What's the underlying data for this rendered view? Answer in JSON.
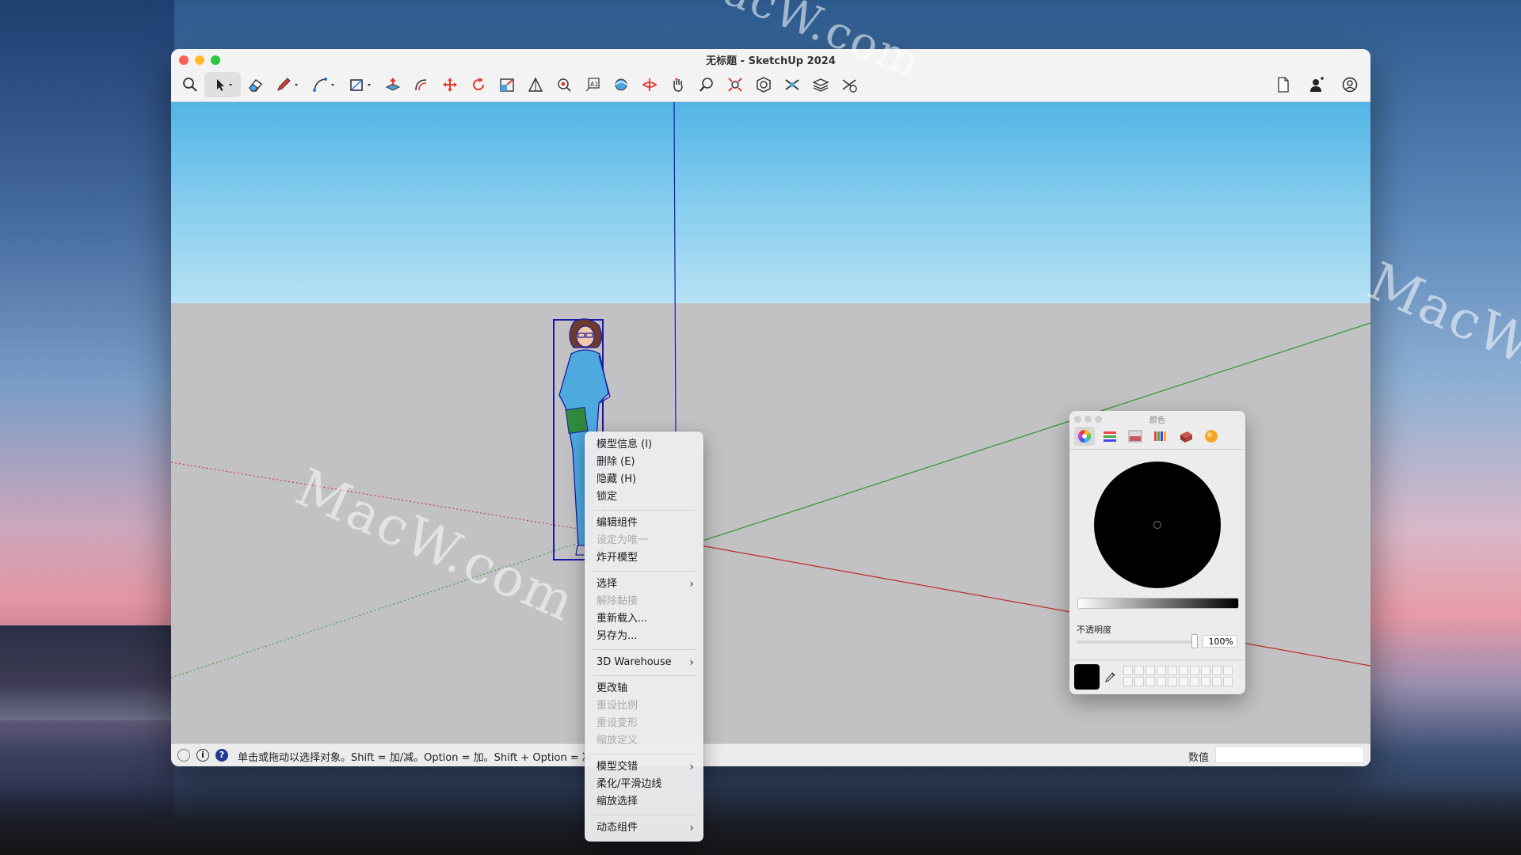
{
  "window": {
    "title": "无标题 - SketchUp 2024"
  },
  "toolbar": {
    "tools": [
      "search-icon",
      "select-icon",
      "eraser-icon",
      "pencil-icon",
      "arc-icon",
      "rectangle-icon",
      "push-pull-icon",
      "offset-icon",
      "move-icon",
      "rotate-icon",
      "scale-icon",
      "tape-measure-icon",
      "paint-bucket-icon",
      "text-icon",
      "orbit-icon",
      "section-icon",
      "pan-icon",
      "zoom-icon",
      "zoom-extents-icon",
      "3d-warehouse-icon",
      "extension-warehouse-icon",
      "layers-icon",
      "settings-icon"
    ],
    "right_icons": [
      "document-icon",
      "add-user-icon",
      "account-icon"
    ]
  },
  "context_menu": {
    "items": [
      {
        "label": "模型信息 (I)",
        "disabled": false,
        "submenu": false
      },
      {
        "label": "删除 (E)",
        "disabled": false,
        "submenu": false
      },
      {
        "label": "隐藏 (H)",
        "disabled": false,
        "submenu": false
      },
      {
        "label": "锁定",
        "disabled": false,
        "submenu": false
      },
      {
        "sep": true
      },
      {
        "label": "编辑组件",
        "disabled": false,
        "submenu": false
      },
      {
        "label": "设定为唯一",
        "disabled": true,
        "submenu": false
      },
      {
        "label": "炸开模型",
        "disabled": false,
        "submenu": false
      },
      {
        "sep": true
      },
      {
        "label": "选择",
        "disabled": false,
        "submenu": true
      },
      {
        "label": "解除黏接",
        "disabled": true,
        "submenu": false
      },
      {
        "label": "重新载入...",
        "disabled": false,
        "submenu": false
      },
      {
        "label": "另存为...",
        "disabled": false,
        "submenu": false
      },
      {
        "sep": true
      },
      {
        "label": "3D Warehouse",
        "disabled": false,
        "submenu": true
      },
      {
        "sep": true
      },
      {
        "label": "更改轴",
        "disabled": false,
        "submenu": false
      },
      {
        "label": "重设比例",
        "disabled": true,
        "submenu": false
      },
      {
        "label": "重设变形",
        "disabled": true,
        "submenu": false
      },
      {
        "label": "缩放定义",
        "disabled": true,
        "submenu": false
      },
      {
        "sep": true
      },
      {
        "label": "模型交错",
        "disabled": false,
        "submenu": true
      },
      {
        "label": "柔化/平滑边线",
        "disabled": false,
        "submenu": false
      },
      {
        "label": "缩放选择",
        "disabled": false,
        "submenu": false
      },
      {
        "sep": true
      },
      {
        "label": "动态组件",
        "disabled": false,
        "submenu": true
      }
    ],
    "submenu_arrow": "›"
  },
  "status": {
    "text": "单击或拖动以选择对象。Shift = 加/减。Option = 加。Shift + Option = 减。",
    "value_label": "数值",
    "value": ""
  },
  "color_panel": {
    "title": "颜色",
    "opacity_label": "不透明度",
    "opacity_value": "100%",
    "current_color": "#000000"
  },
  "watermarks": [
    "MacW.com",
    "MacW.com",
    "MacW.c"
  ],
  "colors": {
    "sky_top": "#53b5e6",
    "ground": "#c2c2c4",
    "selection": "#1a1aa8",
    "axis_red": "#c0282a",
    "axis_green": "#2a9a2a",
    "axis_blue": "#1a1ab8"
  }
}
